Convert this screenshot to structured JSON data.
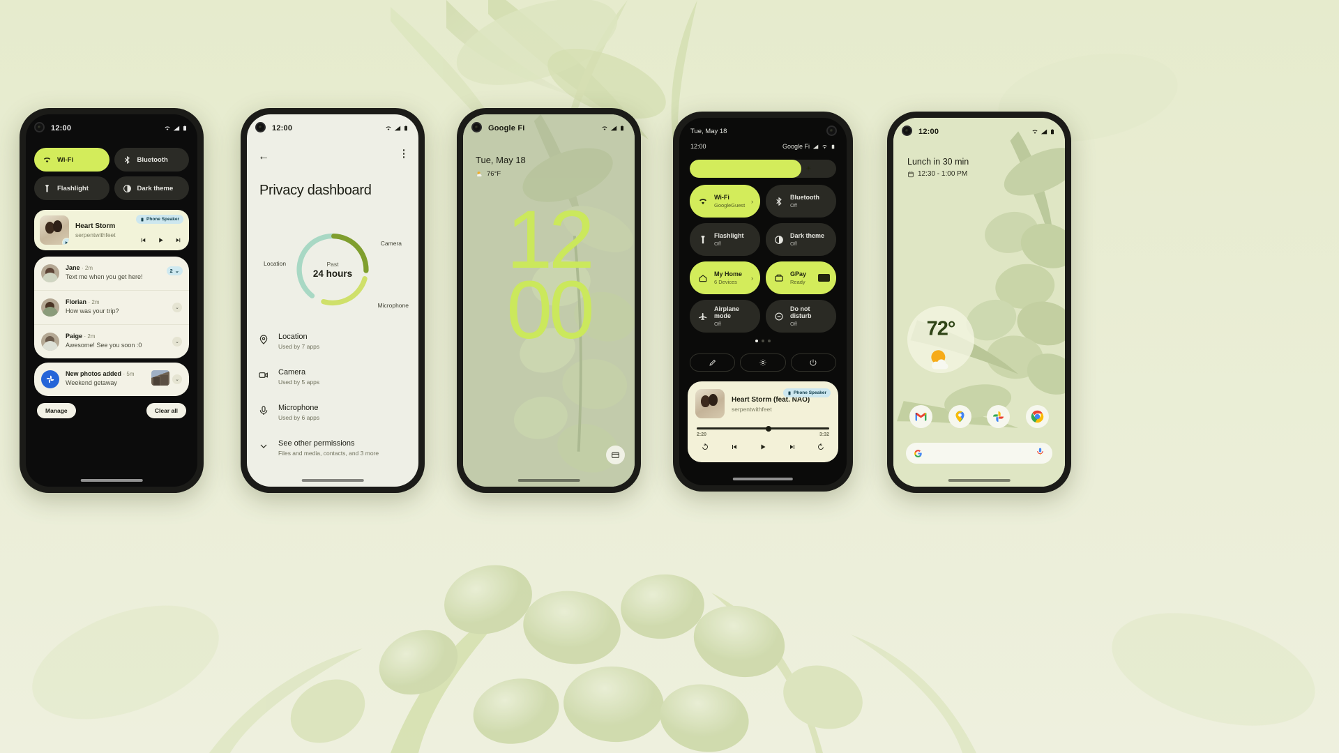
{
  "background": {
    "wallpaper": "botanical-foxglove-green",
    "page_bg": "#edefdd"
  },
  "phone1": {
    "name": "notification-shade",
    "statusbar": {
      "time": "12:00",
      "icons": [
        "wifi-icon",
        "signal-icon",
        "battery-icon"
      ]
    },
    "quick_tiles": [
      {
        "label": "Wi-Fi",
        "icon": "wifi-icon",
        "state": "on"
      },
      {
        "label": "Bluetooth",
        "icon": "bluetooth-icon",
        "state": "off"
      },
      {
        "label": "Flashlight",
        "icon": "flashlight-icon",
        "state": "off"
      },
      {
        "label": "Dark theme",
        "icon": "contrast-icon",
        "state": "off"
      }
    ],
    "media": {
      "title": "Heart Storm",
      "artist": "serpentwithfeet",
      "output_chip": "Phone Speaker",
      "controls": [
        "previous-icon",
        "play-icon",
        "next-icon"
      ]
    },
    "notifications": [
      {
        "name": "Jane",
        "time": "2m",
        "text": "Text me when you get here!",
        "badge": "2"
      },
      {
        "name": "Florian",
        "time": "2m",
        "text": "How was your trip?",
        "badge": ""
      },
      {
        "name": "Paige",
        "time": "2m",
        "text": "Awesome! See you soon :0",
        "badge": ""
      }
    ],
    "photo_notification": {
      "name": "New photos added",
      "time": "5m",
      "text": "Weekend getaway"
    },
    "actions": {
      "manage": "Manage",
      "clear_all": "Clear all"
    }
  },
  "phone2": {
    "name": "privacy-dashboard",
    "statusbar": {
      "time": "12:00"
    },
    "title": "Privacy dashboard",
    "donut": {
      "center_top": "Past",
      "center_main": "24 hours"
    },
    "donut_labels": {
      "location": "Location",
      "camera": "Camera",
      "microphone": "Microphone"
    },
    "permissions": [
      {
        "name": "Location",
        "sub": "Used by 7 apps",
        "icon": "location-pin-icon"
      },
      {
        "name": "Camera",
        "sub": "Used by 5 apps",
        "icon": "camera-icon"
      },
      {
        "name": "Microphone",
        "sub": "Used by 6 apps",
        "icon": "microphone-icon"
      },
      {
        "name": "See other permissions",
        "sub": "Files and media, contacts, and 3 more",
        "icon": "chevron-down-icon"
      }
    ]
  },
  "phone3": {
    "name": "lock-screen",
    "statusbar": {
      "carrier": "Google Fi",
      "icons": [
        "wifi-icon",
        "signal-icon",
        "battery-icon"
      ]
    },
    "date": "Tue, May 18",
    "weather": "76°F",
    "clock": {
      "hours": "12",
      "minutes": "00"
    },
    "wallet_button": "wallet-icon"
  },
  "phone4": {
    "name": "quick-settings-expanded",
    "date": "Tue, May 18",
    "time": "12:00",
    "carrier": "Google Fi",
    "brightness_percent": 76,
    "tiles": [
      {
        "label": "Wi-Fi",
        "sub": "GoogleGuest",
        "icon": "wifi-icon",
        "state": "on",
        "arrow": true
      },
      {
        "label": "Bluetooth",
        "sub": "Off",
        "icon": "bluetooth-icon",
        "state": "off",
        "arrow": false
      },
      {
        "label": "Flashlight",
        "sub": "Off",
        "icon": "flashlight-icon",
        "state": "off",
        "arrow": false
      },
      {
        "label": "Dark theme",
        "sub": "Off",
        "icon": "contrast-icon",
        "state": "off",
        "arrow": false
      },
      {
        "label": "My Home",
        "sub": "6 Devices",
        "icon": "home-icon",
        "state": "on",
        "arrow": true
      },
      {
        "label": "GPay",
        "sub": "Ready",
        "icon": "wallet-icon",
        "state": "on",
        "arrow": false
      },
      {
        "label": "Airplane mode",
        "sub": "Off",
        "icon": "airplane-icon",
        "state": "off",
        "arrow": false
      },
      {
        "label": "Do not disturb",
        "sub": "Off",
        "icon": "do-not-disturb-icon",
        "state": "off",
        "arrow": false
      }
    ],
    "page_dots": {
      "count": 3,
      "active_index": 0
    },
    "utility_buttons": [
      "edit-pencil-icon",
      "settings-gear-icon",
      "power-icon"
    ],
    "media": {
      "title": "Heart Storm (feat. NAO)",
      "artist": "serpentwithfeet",
      "output_chip": "Phone Speaker",
      "elapsed": "2:20",
      "duration": "3:32",
      "progress_percent": 54,
      "controls": [
        "replay-10-icon",
        "previous-icon",
        "play-icon",
        "next-icon",
        "forward-10-icon"
      ]
    }
  },
  "phone5": {
    "name": "home-screen",
    "statusbar": {
      "time": "12:00",
      "icons": [
        "wifi-icon",
        "signal-icon",
        "battery-icon"
      ]
    },
    "at_a_glance": {
      "title": "Lunch in 30 min",
      "time_range": "12:30 - 1:00 PM",
      "icon": "calendar-icon"
    },
    "weather_widget": {
      "temperature": "72°",
      "icon": "partly-sunny-icon"
    },
    "dock_apps": [
      "gmail-icon",
      "google-maps-icon",
      "google-photos-icon",
      "chrome-icon"
    ],
    "search_bar": {
      "leading_icon": "google-g-icon",
      "trailing_icon": "microphone-icon",
      "placeholder": ""
    }
  },
  "colors": {
    "accent_lime": "#d3ec5b",
    "dark_surface": "#2a2a24",
    "cream_surface": "#f3f2e6",
    "chip_blue": "#cde7ef",
    "page_bg": "#edefdd"
  }
}
